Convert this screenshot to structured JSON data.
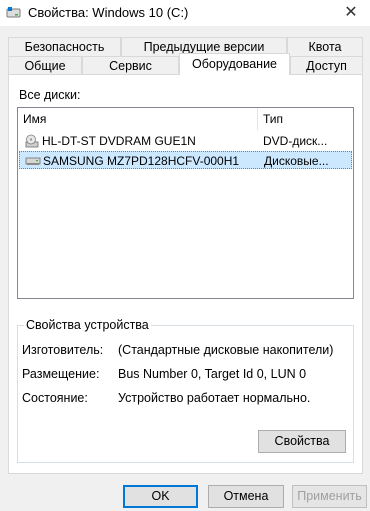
{
  "window": {
    "title": "Свойства: Windows 10 (C:)",
    "close_glyph": "✕"
  },
  "tabs_back": [
    {
      "label": "Безопасность"
    },
    {
      "label": "Предыдущие версии"
    },
    {
      "label": "Квота"
    }
  ],
  "tabs_front": [
    {
      "label": "Общие"
    },
    {
      "label": "Сервис"
    },
    {
      "label": "Оборудование",
      "active": true
    },
    {
      "label": "Доступ"
    }
  ],
  "disks": {
    "label": "Все диски:",
    "columns": [
      "Имя",
      "Тип"
    ],
    "rows": [
      {
        "icon": "dvd-drive-icon",
        "name": "HL-DT-ST DVDRAM GUE1N",
        "type": "DVD-диск...",
        "selected": false
      },
      {
        "icon": "hard-drive-icon",
        "name": "SAMSUNG MZ7PD128HCFV-000H1",
        "type": "Дисковые...",
        "selected": true
      }
    ]
  },
  "device_properties": {
    "title": "Свойства устройства",
    "fields": [
      {
        "label": "Изготовитель:",
        "value": "(Стандартные дисковые накопители)"
      },
      {
        "label": "Размещение:",
        "value": "Bus Number 0, Target Id 0, LUN 0"
      },
      {
        "label": "Состояние:",
        "value": "Устройство работает нормально."
      }
    ],
    "properties_button": "Свойства"
  },
  "footer": {
    "ok": "OK",
    "cancel": "Отмена",
    "apply": "Применить"
  }
}
